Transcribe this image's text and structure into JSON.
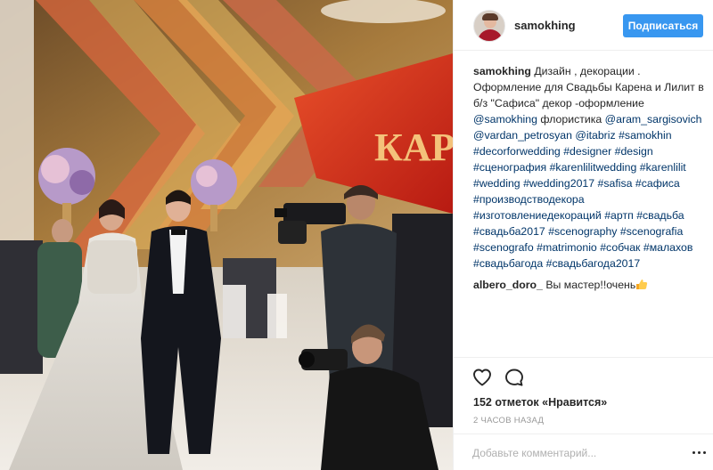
{
  "post": {
    "username": "samokhing",
    "follow_label": "Подписаться",
    "icons": {
      "like": "heart-icon",
      "comment": "comment-bubble-icon",
      "more": "more-dots-icon",
      "avatar": "profile-avatar"
    },
    "accent_color": "#3897f0",
    "link_color": "#003569"
  },
  "caption": {
    "user": "samokhing",
    "text": "Дизайн , декорации . Оформление для Свадьбы Карена и Лилит в б/з \"Сафиса\" декор -оформление",
    "mention_1": "@samokhing",
    "text_2": "флористика",
    "mention_2": "@aram_sargisovich",
    "mention_3": "@vardan_petrosyan",
    "mention_4": "@itabriz",
    "tags": [
      "#samokhin",
      "#decorforwedding",
      "#designer",
      "#design",
      "#сценография",
      "#karenlilitwedding",
      "#karenlilit",
      "#wedding",
      "#wedding2017",
      "#safisa",
      "#сафиса",
      "#производстводекора",
      "#изготовлениедекораций",
      "#артп",
      "#свадьба",
      "#свадьба2017",
      "#scenography",
      "#scenografia",
      "#scenografo",
      "#matrimonio",
      "#собчак",
      "#малахов",
      "#свадьбагода",
      "#свадьбагода2017"
    ]
  },
  "comment": {
    "user": "albero_doro_",
    "text": "Вы мастер!!очень"
  },
  "likes": "152 отметок «Нравится»",
  "time": "2 часов назад",
  "add_comment_placeholder": "Добавьте комментарий...",
  "photo": {
    "sign_text": "КАР"
  }
}
